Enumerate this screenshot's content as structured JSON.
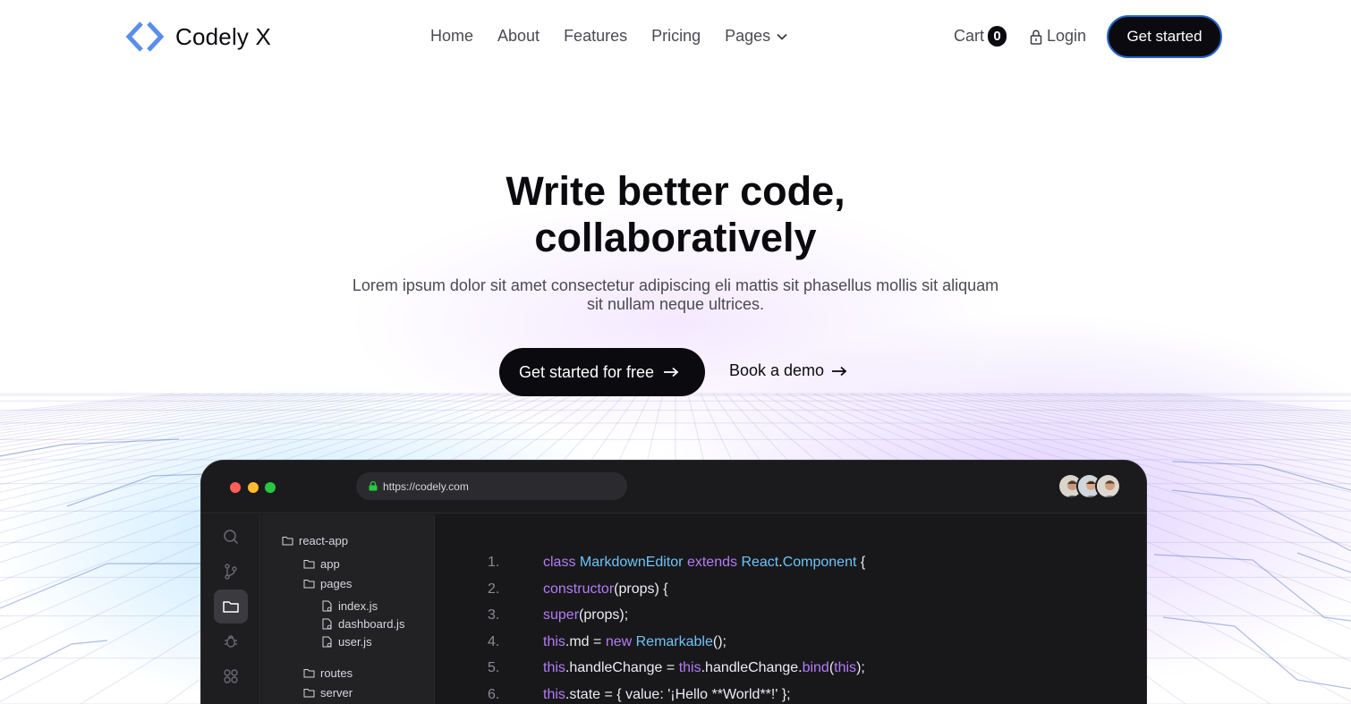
{
  "brand": {
    "name": "Codely X"
  },
  "nav": {
    "items": [
      "Home",
      "About",
      "Features",
      "Pricing",
      "Pages"
    ]
  },
  "header": {
    "cart_label": "Cart",
    "cart_count": "0",
    "login_label": "Login",
    "cta_label": "Get started"
  },
  "hero": {
    "title_line1": "Write better code,",
    "title_line2": "collaboratively",
    "subtitle_line1": "Lorem ipsum dolor sit amet consectetur adipiscing eli mattis sit phasellus mollis sit aliquam",
    "subtitle_line2": "sit nullam neque ultrices.",
    "primary_cta": "Get started for free",
    "secondary_cta": "Book a demo"
  },
  "editor": {
    "url": "https://codely.com",
    "file_tree": {
      "root": "react-app",
      "items": [
        {
          "label": "app",
          "type": "folder"
        },
        {
          "label": "pages",
          "type": "folder"
        },
        {
          "label": "index.js",
          "type": "file"
        },
        {
          "label": "dashboard.js",
          "type": "file"
        },
        {
          "label": "user.js",
          "type": "file"
        },
        {
          "label": "routes",
          "type": "folder"
        },
        {
          "label": "server",
          "type": "folder"
        }
      ]
    },
    "code_lines": [
      {
        "num": "1.",
        "tokens": [
          [
            "kw",
            "class "
          ],
          [
            "cls",
            "MarkdownEditor "
          ],
          [
            "kw",
            "extends "
          ],
          [
            "cls",
            "React"
          ],
          [
            "plain",
            "."
          ],
          [
            "cls",
            "Component "
          ],
          [
            "plain",
            "{"
          ]
        ]
      },
      {
        "num": "2.",
        "tokens": [
          [
            "plain",
            " "
          ],
          [
            "fn",
            "constructor"
          ],
          [
            "plain",
            "(props) {"
          ]
        ]
      },
      {
        "num": "3.",
        "tokens": [
          [
            "plain",
            "  "
          ],
          [
            "fn",
            "super"
          ],
          [
            "plain",
            "(props);"
          ]
        ]
      },
      {
        "num": "4.",
        "tokens": [
          [
            "plain",
            "  "
          ],
          [
            "kw",
            "this"
          ],
          [
            "plain",
            ".md = "
          ],
          [
            "kw",
            "new "
          ],
          [
            "cls",
            "Remarkable"
          ],
          [
            "plain",
            "();"
          ]
        ]
      },
      {
        "num": "5.",
        "tokens": [
          [
            "plain",
            "  "
          ],
          [
            "kw",
            "this"
          ],
          [
            "plain",
            ".handleChange = "
          ],
          [
            "kw",
            "this"
          ],
          [
            "plain",
            ".handleChange."
          ],
          [
            "fn",
            "bind"
          ],
          [
            "plain",
            "("
          ],
          [
            "kw",
            "this"
          ],
          [
            "plain",
            ");"
          ]
        ]
      },
      {
        "num": "6.",
        "tokens": [
          [
            "plain",
            "  "
          ],
          [
            "kw",
            "this"
          ],
          [
            "plain",
            ".state = { value: '¡Hello **World**!' };"
          ]
        ]
      }
    ]
  },
  "colors": {
    "accent": "#5b8def",
    "dark": "#0b0b0f",
    "keyword": "#b47cf5",
    "class": "#6ec4f7"
  }
}
